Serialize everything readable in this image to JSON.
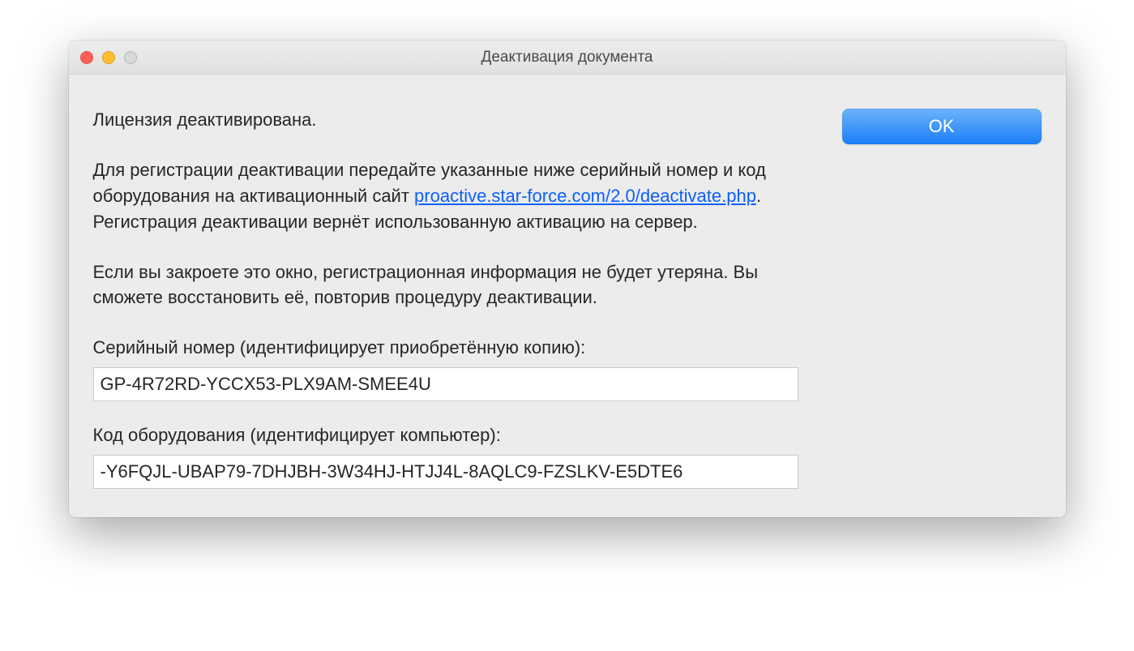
{
  "window": {
    "title": "Деактивация документа"
  },
  "buttons": {
    "ok": "OK"
  },
  "message": {
    "licenseDeactivated": "Лицензия деактивирована.",
    "instruction_before_link": "Для регистрации деактивации передайте указанные ниже серийный номер и код оборудования на активационный сайт ",
    "link_text": "proactive.star-force.com/2.0/deactivate.php",
    "instruction_after_link": ". Регистрация деактивации вернёт использованную активацию на сервер.",
    "closeNote": "Если вы закроете это окно, регистрационная информация не будет утеряна. Вы сможете восстановить её, повторив процедуру деактивации.",
    "serialLabel": "Серийный номер (идентифицирует приобретённую копию):",
    "hardwareLabel": "Код оборудования (идентифицирует компьютер):"
  },
  "values": {
    "serial": "GP-4R72RD-YCCX53-PLX9AM-SMEE4U",
    "hardware": "-Y6FQJL-UBAP79-7DHJBH-3W34HJ-HTJJ4L-8AQLC9-FZSLKV-E5DTE6"
  }
}
